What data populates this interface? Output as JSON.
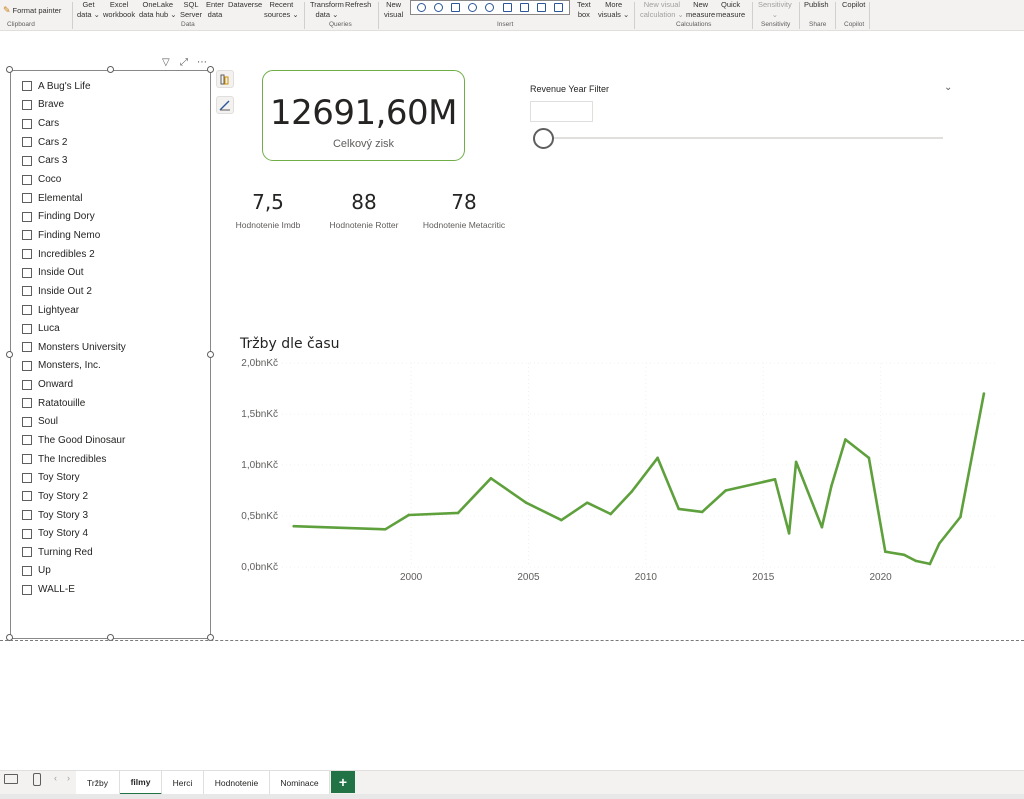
{
  "ribbon": {
    "format_painter": "Format painter",
    "clipboard": "Clipboard",
    "get_data": [
      "Get",
      "data ⌄"
    ],
    "excel": [
      "Excel",
      "workbook"
    ],
    "onelake": [
      "OneLake",
      "data hub ⌄"
    ],
    "sql": [
      "SQL",
      "Server"
    ],
    "enter_data": [
      "Enter",
      "data"
    ],
    "dataverse": "Dataverse",
    "recent": [
      "Recent",
      "sources ⌄"
    ],
    "data_group": "Data",
    "transform": [
      "Transform",
      "data ⌄"
    ],
    "refresh": "Refresh",
    "queries_group": "Queries",
    "new_visual": [
      "New",
      "visual"
    ],
    "insert_group": "Insert",
    "text_box": [
      "Text",
      "box"
    ],
    "more_visuals": [
      "More",
      "visuals ⌄"
    ],
    "new_visual_calc": [
      "New visual",
      "calculation ⌄"
    ],
    "new_measure": [
      "New",
      "measure"
    ],
    "quick_measure": [
      "Quick",
      "measure"
    ],
    "calculations_group": "Calculations",
    "sensitivity": [
      "Sensitivity",
      "⌄"
    ],
    "sensitivity_group": "Sensitivity",
    "publish": "Publish",
    "share_group": "Share",
    "copilot": "Copilot",
    "copilot_group": "Copilot"
  },
  "slicer": {
    "items": [
      "A Bug's Life",
      "Brave",
      "Cars",
      "Cars 2",
      "Cars 3",
      "Coco",
      "Elemental",
      "Finding Dory",
      "Finding Nemo",
      "Incredibles 2",
      "Inside Out",
      "Inside Out 2",
      "Lightyear",
      "Luca",
      "Monsters University",
      "Monsters, Inc.",
      "Onward",
      "Ratatouille",
      "Soul",
      "The Good Dinosaur",
      "The Incredibles",
      "Toy Story",
      "Toy Story 2",
      "Toy Story 3",
      "Toy Story 4",
      "Turning Red",
      "Up",
      "WALL-E"
    ]
  },
  "kpi": {
    "value": "12691,60M",
    "label": "Celkový zisk"
  },
  "ratings": [
    {
      "value": "7,5",
      "label": "Hodnotenie Imdb"
    },
    {
      "value": "88",
      "label": "Hodnotenie Rotter"
    },
    {
      "value": "78",
      "label": "Hodnotenie Metacritic"
    }
  ],
  "year_filter": {
    "title": "Revenue Year Filter",
    "chevron": "⌄"
  },
  "chart_data": {
    "type": "line",
    "title": "Tržby dle času",
    "xlabel": "",
    "ylabel": "",
    "x_ticks": [
      "2000",
      "2005",
      "2010",
      "2015",
      "2020"
    ],
    "y_ticks": [
      "0,0bnKč",
      "0,5bnKč",
      "1,0bnKč",
      "1,5bnKč",
      "2,0bnKč"
    ],
    "ylim": [
      0,
      2.0
    ],
    "xlim": [
      1994.5,
      2025
    ],
    "grid": true,
    "color": "#5ea03c",
    "series": [
      {
        "x": [
          1995,
          1998.9,
          1999.9,
          2002,
          2003.4,
          2004.9,
          2006.4,
          2007.5,
          2008.5,
          2009.4,
          2010.5,
          2011.4,
          2012.4,
          2013.4,
          2015.5,
          2016.1,
          2016.4,
          2017.5,
          2017.9,
          2018.5,
          2019.5,
          2020.2,
          2021,
          2021.5,
          2022.1,
          2022.5,
          2023.4,
          2024.4
        ],
        "values": [
          0.4,
          0.37,
          0.51,
          0.53,
          0.87,
          0.63,
          0.46,
          0.63,
          0.52,
          0.74,
          1.07,
          0.57,
          0.54,
          0.75,
          0.86,
          0.33,
          1.03,
          0.39,
          0.79,
          1.25,
          1.07,
          0.15,
          0.12,
          0.06,
          0.03,
          0.23,
          0.49,
          1.7
        ]
      }
    ]
  },
  "page_tabs": [
    "Tržby",
    "filmy",
    "Herci",
    "Hodnotenie",
    "Nominace"
  ],
  "active_tab": "filmy",
  "add_tab": "+"
}
